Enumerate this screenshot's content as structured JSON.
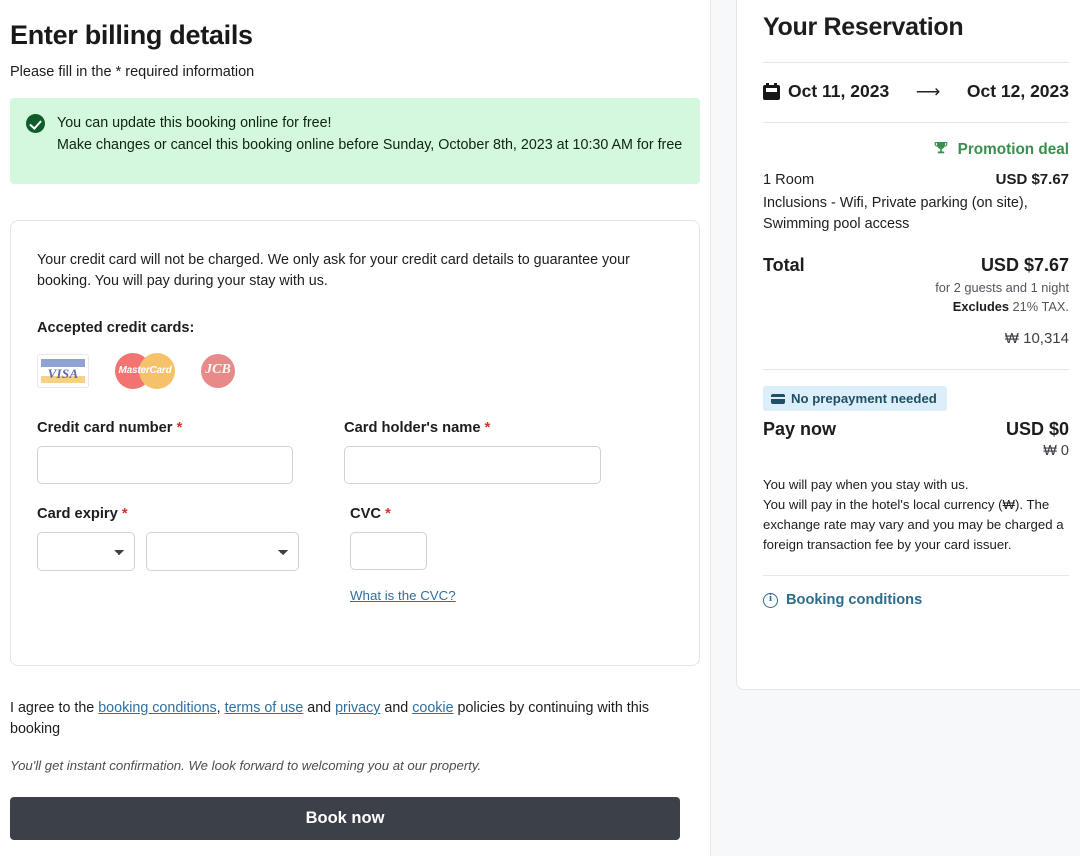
{
  "billing": {
    "title": "Enter billing details",
    "subtitle": "Please fill in the * required information",
    "alert": {
      "icon": "check-circle-icon",
      "line1": "You can update this booking online for free!",
      "line2": "Make changes or cancel this booking online before Sunday, October 8th, 2023 at 10:30 AM for free",
      "bg_color": "#d4f8dd",
      "icon_color": "#0d5c2b"
    },
    "card_section": {
      "note": "Your credit card will not be charged. We only ask for your credit card details to guarantee your booking. You will pay during your stay with us.",
      "accepted_label": "Accepted credit cards:",
      "logos": [
        {
          "name": "visa-logo",
          "text": "VISA"
        },
        {
          "name": "mastercard-logo",
          "text": "MasterCard"
        },
        {
          "name": "jcb-logo",
          "text": "JCB"
        }
      ],
      "fields": {
        "card_number_label": "Credit card number",
        "card_number_value": "",
        "card_number_placeholder": "",
        "holder_name_label": "Card holder's name",
        "holder_name_value": "",
        "holder_name_placeholder": "",
        "expiry_label": "Card expiry",
        "expiry_month_value": "",
        "expiry_year_value": "",
        "cvc_label": "CVC",
        "cvc_value": "",
        "cvc_placeholder": "",
        "required_marker": "*",
        "cvc_help_link": "What is the CVC?"
      }
    },
    "agreement": {
      "part1": "I agree to the ",
      "link_booking_conditions": "booking conditions",
      "sep1": ", ",
      "link_terms": "terms of use",
      "sep2": " and ",
      "link_privacy": "privacy",
      "sep3": " and ",
      "link_cookie": "cookie",
      "part2": " policies by continuing with this booking"
    },
    "instant_note": "You'll get instant confirmation. We look forward to welcoming you at our property.",
    "book_button": "Book now",
    "book_button_color": "#3c4149"
  },
  "reservation": {
    "title": "Your Reservation",
    "calendar_icon": "calendar-icon",
    "date_in": "Oct 11, 2023",
    "arrow": "⟶",
    "date_out": "Oct 12, 2023",
    "promotion": {
      "icon": "trophy-icon",
      "label": "Promotion deal",
      "color": "#3a8f4e"
    },
    "room_label": "1 Room",
    "room_price": "USD $7.67",
    "inclusions": "Inclusions - Wifi, Private parking (on site), Swimming pool access",
    "total_label": "Total",
    "total_price": "USD $7.67",
    "guests_note": "for 2 guests and 1 night",
    "tax_bold": "Excludes",
    "tax_rest": " 21% TAX.",
    "krw_total": "₩ 10,314",
    "prepayment_badge": {
      "icon": "credit-card-icon",
      "label": "No prepayment needed",
      "bg_color": "#ddeefb",
      "text_color": "#1d4f66"
    },
    "pay_now_label": "Pay now",
    "pay_now_price": "USD $0",
    "pay_now_krw": "₩ 0",
    "pay_note_line1": "You will pay when you stay with us.",
    "pay_note_line2": "You will pay in the hotel's local currency (₩). The exchange rate may vary and you may be charged a foreign transaction fee by your card issuer.",
    "booking_conditions": {
      "icon": "info-icon",
      "label": "Booking conditions",
      "color": "#2e6c8e"
    }
  }
}
